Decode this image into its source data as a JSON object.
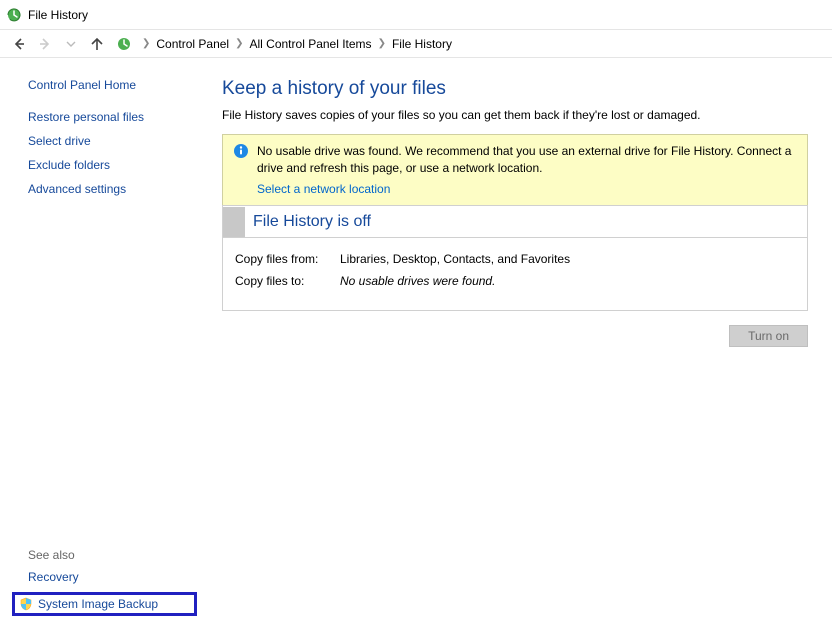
{
  "window": {
    "title": "File History"
  },
  "breadcrumb": {
    "items": [
      "Control Panel",
      "All Control Panel Items",
      "File History"
    ]
  },
  "sidebar": {
    "home": "Control Panel Home",
    "links": [
      "Restore personal files",
      "Select drive",
      "Exclude folders",
      "Advanced settings"
    ],
    "see_also_title": "See also",
    "see_also": [
      "Recovery",
      "System Image Backup"
    ]
  },
  "main": {
    "title": "Keep a history of your files",
    "description": "File History saves copies of your files so you can get them back if they're lost or damaged.",
    "alert": {
      "text": "No usable drive was found. We recommend that you use an external drive for File History. Connect a drive and refresh this page, or use a network location.",
      "link": "Select a network location"
    },
    "status": {
      "title": "File History is off",
      "rows": [
        {
          "label": "Copy files from:",
          "value": "Libraries, Desktop, Contacts, and Favorites",
          "italic": false
        },
        {
          "label": "Copy files to:",
          "value": "No usable drives were found.",
          "italic": true
        }
      ]
    },
    "turn_on": "Turn on"
  }
}
